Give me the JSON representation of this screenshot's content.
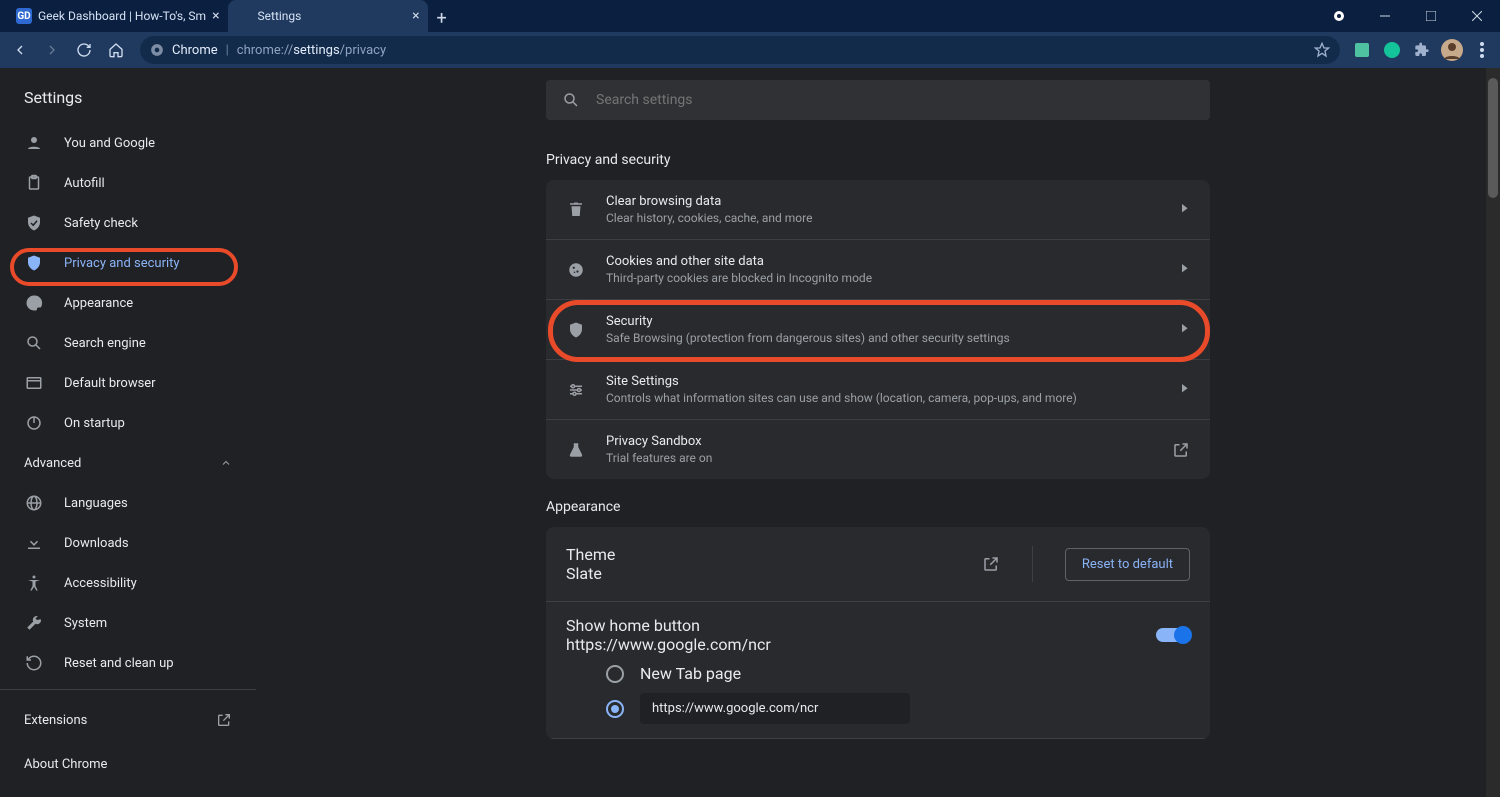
{
  "tabs": {
    "inactive_title": "Geek Dashboard | How-To's, Sm",
    "active_title": "Settings"
  },
  "omnibox": {
    "chip": "Chrome",
    "url_prefix": "chrome://",
    "url_strong": "settings",
    "url_suffix": "/privacy"
  },
  "app_title": "Settings",
  "search_placeholder": "Search settings",
  "sidebar": {
    "items": [
      {
        "icon": "person",
        "label": "You and Google"
      },
      {
        "icon": "clipboard",
        "label": "Autofill"
      },
      {
        "icon": "shield-check",
        "label": "Safety check"
      },
      {
        "icon": "shield",
        "label": "Privacy and security"
      },
      {
        "icon": "palette",
        "label": "Appearance"
      },
      {
        "icon": "search",
        "label": "Search engine"
      },
      {
        "icon": "browser",
        "label": "Default browser"
      },
      {
        "icon": "power",
        "label": "On startup"
      }
    ],
    "advanced_label": "Advanced",
    "advanced_items": [
      {
        "icon": "globe",
        "label": "Languages"
      },
      {
        "icon": "download",
        "label": "Downloads"
      },
      {
        "icon": "accessibility",
        "label": "Accessibility"
      },
      {
        "icon": "wrench",
        "label": "System"
      },
      {
        "icon": "restore",
        "label": "Reset and clean up"
      }
    ],
    "extensions_label": "Extensions",
    "about_label": "About Chrome"
  },
  "sections": {
    "privacy": {
      "title": "Privacy and security",
      "rows": [
        {
          "icon": "trash",
          "title": "Clear browsing data",
          "sub": "Clear history, cookies, cache, and more",
          "end": "chevron"
        },
        {
          "icon": "cookie",
          "title": "Cookies and other site data",
          "sub": "Third-party cookies are blocked in Incognito mode",
          "end": "chevron"
        },
        {
          "icon": "shield",
          "title": "Security",
          "sub": "Safe Browsing (protection from dangerous sites) and other security settings",
          "end": "chevron"
        },
        {
          "icon": "sliders",
          "title": "Site Settings",
          "sub": "Controls what information sites can use and show (location, camera, pop-ups, and more)",
          "end": "chevron"
        },
        {
          "icon": "flask",
          "title": "Privacy Sandbox",
          "sub": "Trial features are on",
          "end": "launch"
        }
      ]
    },
    "appearance": {
      "title": "Appearance",
      "theme_label": "Theme",
      "theme_value": "Slate",
      "reset_label": "Reset to default",
      "home_button_label": "Show home button",
      "home_url": "https://www.google.com/ncr",
      "radio_newtab": "New Tab page",
      "radio_url_value": "https://www.google.com/ncr"
    }
  }
}
